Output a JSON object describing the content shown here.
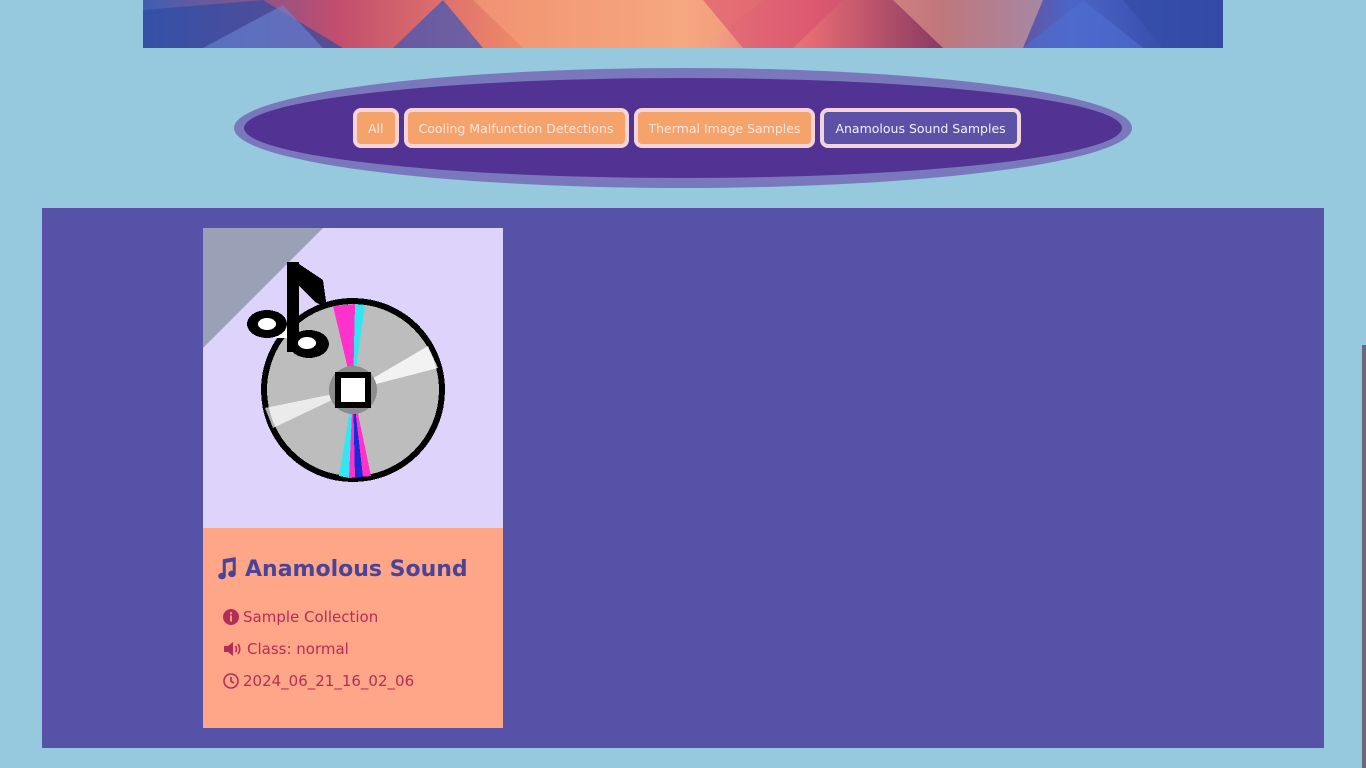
{
  "filters": {
    "items": [
      {
        "label": "All",
        "active": false
      },
      {
        "label": "Cooling Malfunction Detections",
        "active": false
      },
      {
        "label": "Thermal Image Samples",
        "active": false
      },
      {
        "label": "Anamolous Sound Samples",
        "active": true
      }
    ]
  },
  "cards": [
    {
      "title": "Anamolous Sound",
      "title_icon": "music-icon",
      "image_icon": "cd-music-icon",
      "source": "Sample Collection",
      "class_text": "Class: normal",
      "timestamp": "2024_06_21_16_02_06"
    }
  ],
  "colors": {
    "background": "#96c8de",
    "filter_bar": "#523292",
    "filter_bar_border": "#7a78bd",
    "filter_button": "#f5a36b",
    "filter_button_active": "#5b52a8",
    "gallery": "#5552a7",
    "card_image_bg": "#ddd3fb",
    "card_body": "#ffa688",
    "card_title": "#4a4499",
    "card_meta": "#b42d57"
  }
}
